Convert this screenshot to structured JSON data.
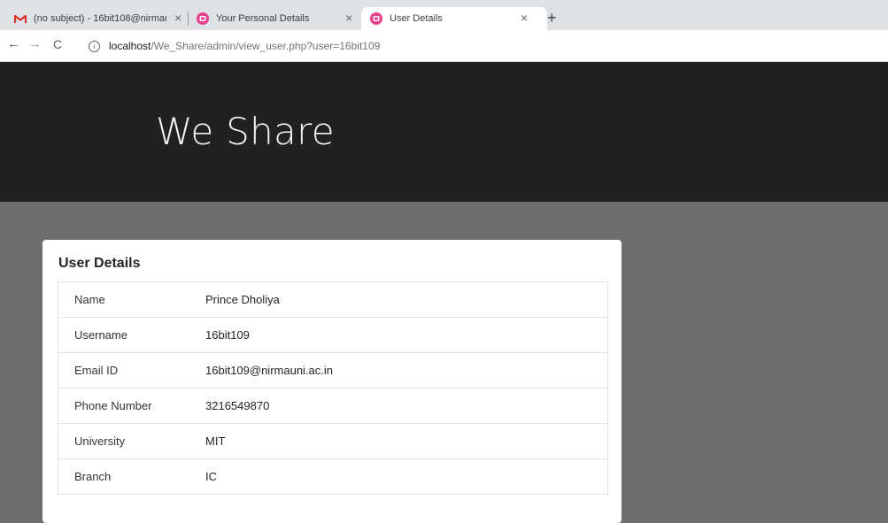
{
  "browser": {
    "tabs": [
      {
        "title": "(no subject) - 16bit108@nirmaun",
        "close": "×",
        "favicon": "gmail-icon"
      },
      {
        "title": "Your Personal Details",
        "close": "×",
        "favicon": "site-icon"
      },
      {
        "title": "User Details",
        "close": "×",
        "favicon": "site-icon",
        "active": true
      }
    ],
    "new_tab": "+",
    "nav": {
      "back": "←",
      "forward": "→",
      "reload": "C"
    },
    "url_host": "localhost",
    "url_path": "/We_Share/admin/view_user.php?user=16bit109",
    "info_glyph": "i"
  },
  "site": {
    "brand": "We Share"
  },
  "card": {
    "title": "User Details",
    "rows": [
      {
        "label": "Name",
        "value": "Prince Dholiya"
      },
      {
        "label": "Username",
        "value": "16bit109"
      },
      {
        "label": "Email ID",
        "value": "16bit109@nirmauni.ac.in"
      },
      {
        "label": "Phone Number",
        "value": "3216549870"
      },
      {
        "label": "University",
        "value": "MIT"
      },
      {
        "label": "Branch",
        "value": "IC"
      }
    ]
  },
  "colors": {
    "hero_bg": "#212124",
    "page_bg": "#6e6e71",
    "favicon_pink": "#e83e8c",
    "gmail_red": "#d93025"
  }
}
